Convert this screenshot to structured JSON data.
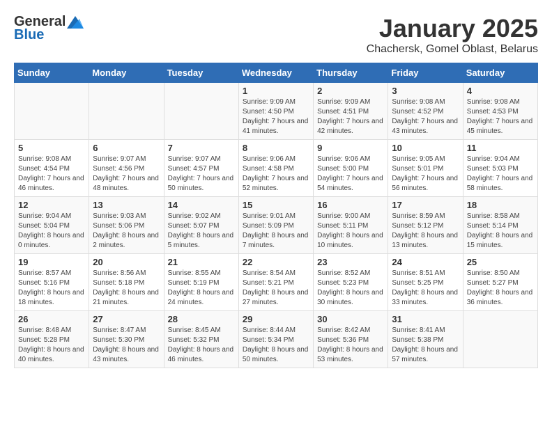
{
  "header": {
    "logo_general": "General",
    "logo_blue": "Blue",
    "month_title": "January 2025",
    "location": "Chachersk, Gomel Oblast, Belarus"
  },
  "weekdays": [
    "Sunday",
    "Monday",
    "Tuesday",
    "Wednesday",
    "Thursday",
    "Friday",
    "Saturday"
  ],
  "weeks": [
    [
      {
        "day": "",
        "info": ""
      },
      {
        "day": "",
        "info": ""
      },
      {
        "day": "",
        "info": ""
      },
      {
        "day": "1",
        "info": "Sunrise: 9:09 AM\nSunset: 4:50 PM\nDaylight: 7 hours and 41 minutes."
      },
      {
        "day": "2",
        "info": "Sunrise: 9:09 AM\nSunset: 4:51 PM\nDaylight: 7 hours and 42 minutes."
      },
      {
        "day": "3",
        "info": "Sunrise: 9:08 AM\nSunset: 4:52 PM\nDaylight: 7 hours and 43 minutes."
      },
      {
        "day": "4",
        "info": "Sunrise: 9:08 AM\nSunset: 4:53 PM\nDaylight: 7 hours and 45 minutes."
      }
    ],
    [
      {
        "day": "5",
        "info": "Sunrise: 9:08 AM\nSunset: 4:54 PM\nDaylight: 7 hours and 46 minutes."
      },
      {
        "day": "6",
        "info": "Sunrise: 9:07 AM\nSunset: 4:56 PM\nDaylight: 7 hours and 48 minutes."
      },
      {
        "day": "7",
        "info": "Sunrise: 9:07 AM\nSunset: 4:57 PM\nDaylight: 7 hours and 50 minutes."
      },
      {
        "day": "8",
        "info": "Sunrise: 9:06 AM\nSunset: 4:58 PM\nDaylight: 7 hours and 52 minutes."
      },
      {
        "day": "9",
        "info": "Sunrise: 9:06 AM\nSunset: 5:00 PM\nDaylight: 7 hours and 54 minutes."
      },
      {
        "day": "10",
        "info": "Sunrise: 9:05 AM\nSunset: 5:01 PM\nDaylight: 7 hours and 56 minutes."
      },
      {
        "day": "11",
        "info": "Sunrise: 9:04 AM\nSunset: 5:03 PM\nDaylight: 7 hours and 58 minutes."
      }
    ],
    [
      {
        "day": "12",
        "info": "Sunrise: 9:04 AM\nSunset: 5:04 PM\nDaylight: 8 hours and 0 minutes."
      },
      {
        "day": "13",
        "info": "Sunrise: 9:03 AM\nSunset: 5:06 PM\nDaylight: 8 hours and 2 minutes."
      },
      {
        "day": "14",
        "info": "Sunrise: 9:02 AM\nSunset: 5:07 PM\nDaylight: 8 hours and 5 minutes."
      },
      {
        "day": "15",
        "info": "Sunrise: 9:01 AM\nSunset: 5:09 PM\nDaylight: 8 hours and 7 minutes."
      },
      {
        "day": "16",
        "info": "Sunrise: 9:00 AM\nSunset: 5:11 PM\nDaylight: 8 hours and 10 minutes."
      },
      {
        "day": "17",
        "info": "Sunrise: 8:59 AM\nSunset: 5:12 PM\nDaylight: 8 hours and 13 minutes."
      },
      {
        "day": "18",
        "info": "Sunrise: 8:58 AM\nSunset: 5:14 PM\nDaylight: 8 hours and 15 minutes."
      }
    ],
    [
      {
        "day": "19",
        "info": "Sunrise: 8:57 AM\nSunset: 5:16 PM\nDaylight: 8 hours and 18 minutes."
      },
      {
        "day": "20",
        "info": "Sunrise: 8:56 AM\nSunset: 5:18 PM\nDaylight: 8 hours and 21 minutes."
      },
      {
        "day": "21",
        "info": "Sunrise: 8:55 AM\nSunset: 5:19 PM\nDaylight: 8 hours and 24 minutes."
      },
      {
        "day": "22",
        "info": "Sunrise: 8:54 AM\nSunset: 5:21 PM\nDaylight: 8 hours and 27 minutes."
      },
      {
        "day": "23",
        "info": "Sunrise: 8:52 AM\nSunset: 5:23 PM\nDaylight: 8 hours and 30 minutes."
      },
      {
        "day": "24",
        "info": "Sunrise: 8:51 AM\nSunset: 5:25 PM\nDaylight: 8 hours and 33 minutes."
      },
      {
        "day": "25",
        "info": "Sunrise: 8:50 AM\nSunset: 5:27 PM\nDaylight: 8 hours and 36 minutes."
      }
    ],
    [
      {
        "day": "26",
        "info": "Sunrise: 8:48 AM\nSunset: 5:28 PM\nDaylight: 8 hours and 40 minutes."
      },
      {
        "day": "27",
        "info": "Sunrise: 8:47 AM\nSunset: 5:30 PM\nDaylight: 8 hours and 43 minutes."
      },
      {
        "day": "28",
        "info": "Sunrise: 8:45 AM\nSunset: 5:32 PM\nDaylight: 8 hours and 46 minutes."
      },
      {
        "day": "29",
        "info": "Sunrise: 8:44 AM\nSunset: 5:34 PM\nDaylight: 8 hours and 50 minutes."
      },
      {
        "day": "30",
        "info": "Sunrise: 8:42 AM\nSunset: 5:36 PM\nDaylight: 8 hours and 53 minutes."
      },
      {
        "day": "31",
        "info": "Sunrise: 8:41 AM\nSunset: 5:38 PM\nDaylight: 8 hours and 57 minutes."
      },
      {
        "day": "",
        "info": ""
      }
    ]
  ]
}
